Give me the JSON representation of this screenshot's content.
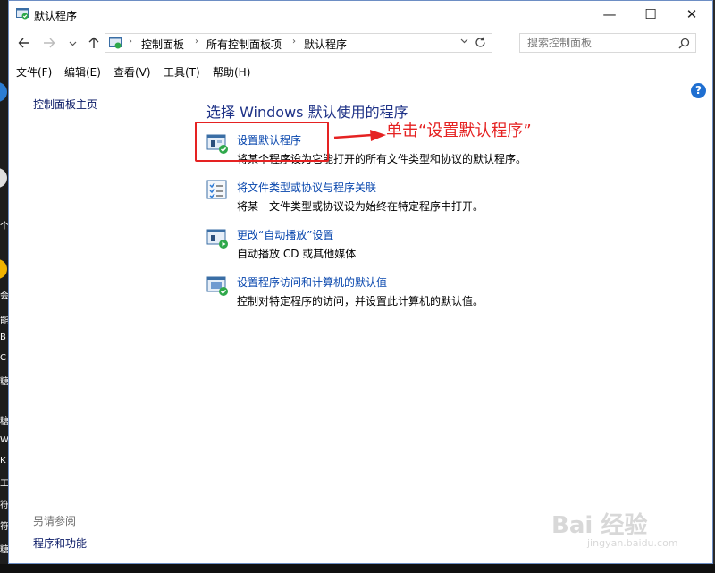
{
  "window": {
    "title": "默认程序",
    "minimize_symbol": "—",
    "maximize_symbol": "☐",
    "close_symbol": "✕"
  },
  "nav": {
    "back_icon": "arrow-left-icon",
    "forward_icon": "arrow-right-icon",
    "dropdown_icon": "chevron-down-icon",
    "up_icon": "arrow-up-icon"
  },
  "address_bar": {
    "breadcrumbs": [
      "控制面板",
      "所有控制面板项",
      "默认程序"
    ],
    "separator": "›",
    "refresh_icon": "refresh-icon"
  },
  "search": {
    "placeholder": "搜索控制面板"
  },
  "menubar": {
    "items": [
      "文件(F)",
      "编辑(E)",
      "查看(V)",
      "工具(T)",
      "帮助(H)"
    ]
  },
  "sidebar": {
    "home_link": "控制面板主页",
    "see_also_label": "另请参阅",
    "see_also_links": [
      "程序和功能"
    ]
  },
  "main": {
    "heading": "选择 Windows 默认使用的程序",
    "tasks": [
      {
        "link": "设置默认程序",
        "description": "将某个程序设为它能打开的所有文件类型和协议的默认程序。",
        "icon": "default-programs-icon"
      },
      {
        "link": "将文件类型或协议与程序关联",
        "description": "将某一文件类型或协议设为始终在特定程序中打开。",
        "icon": "file-association-icon"
      },
      {
        "link": "更改“自动播放”设置",
        "description": "自动播放 CD 或其他媒体",
        "icon": "autoplay-icon"
      },
      {
        "link": "设置程序访问和计算机的默认值",
        "description": "控制对特定程序的访问，并设置此计算机的默认值。",
        "icon": "program-access-icon"
      }
    ]
  },
  "annotation": {
    "text": "单击“设置默认程序”",
    "color": "#e52222"
  },
  "watermark": {
    "text": "Bai 经验",
    "sub": "jingyan.baidu.com"
  },
  "colors": {
    "heading": "#1e3287",
    "link": "#0645ad",
    "sidebar_link": "#0a1a66",
    "muted": "#6d6d6d",
    "help": "#1f6fd1"
  }
}
